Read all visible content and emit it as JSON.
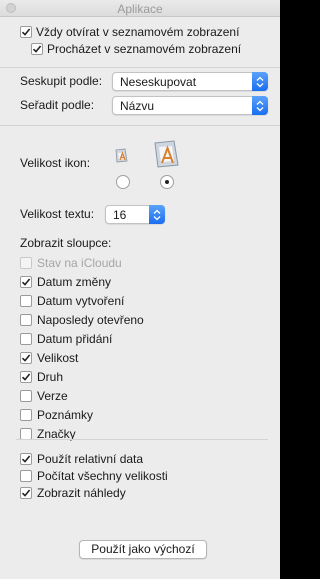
{
  "window": {
    "title": "Aplikace"
  },
  "top": {
    "always_list": {
      "label": "Vždy otvírat v seznamovém zobrazení",
      "checked": true
    },
    "browse_list": {
      "label": "Procházet v seznamovém zobrazení",
      "checked": true
    }
  },
  "group": {
    "label": "Seskupit podle:",
    "value": "Neseskupovat"
  },
  "sort": {
    "label": "Seřadit podle:",
    "value": "Názvu"
  },
  "icon_size": {
    "label": "Velikost ikon:",
    "small_selected": false,
    "large_selected": true
  },
  "text_size": {
    "label": "Velikost textu:",
    "value": "16"
  },
  "columns": {
    "heading": "Zobrazit sloupce:",
    "items": [
      {
        "label": "Stav na iCloudu",
        "checked": false,
        "disabled": true
      },
      {
        "label": "Datum změny",
        "checked": true,
        "disabled": false
      },
      {
        "label": "Datum vytvoření",
        "checked": false,
        "disabled": false
      },
      {
        "label": "Naposledy otevřeno",
        "checked": false,
        "disabled": false
      },
      {
        "label": "Datum přidání",
        "checked": false,
        "disabled": false
      },
      {
        "label": "Velikost",
        "checked": true,
        "disabled": false
      },
      {
        "label": "Druh",
        "checked": true,
        "disabled": false
      },
      {
        "label": "Verze",
        "checked": false,
        "disabled": false
      },
      {
        "label": "Poznámky",
        "checked": false,
        "disabled": false
      },
      {
        "label": "Značky",
        "checked": false,
        "disabled": false
      }
    ]
  },
  "options": {
    "relative_dates": {
      "label": "Použít relativní data",
      "checked": true
    },
    "calc_sizes": {
      "label": "Počítat všechny velikosti",
      "checked": false
    },
    "show_previews": {
      "label": "Zobrazit náhledy",
      "checked": true
    }
  },
  "default_button": {
    "label": "Použít jako výchozí"
  },
  "colors": {
    "accent": "#1a6ef0",
    "background": "#ececec"
  }
}
